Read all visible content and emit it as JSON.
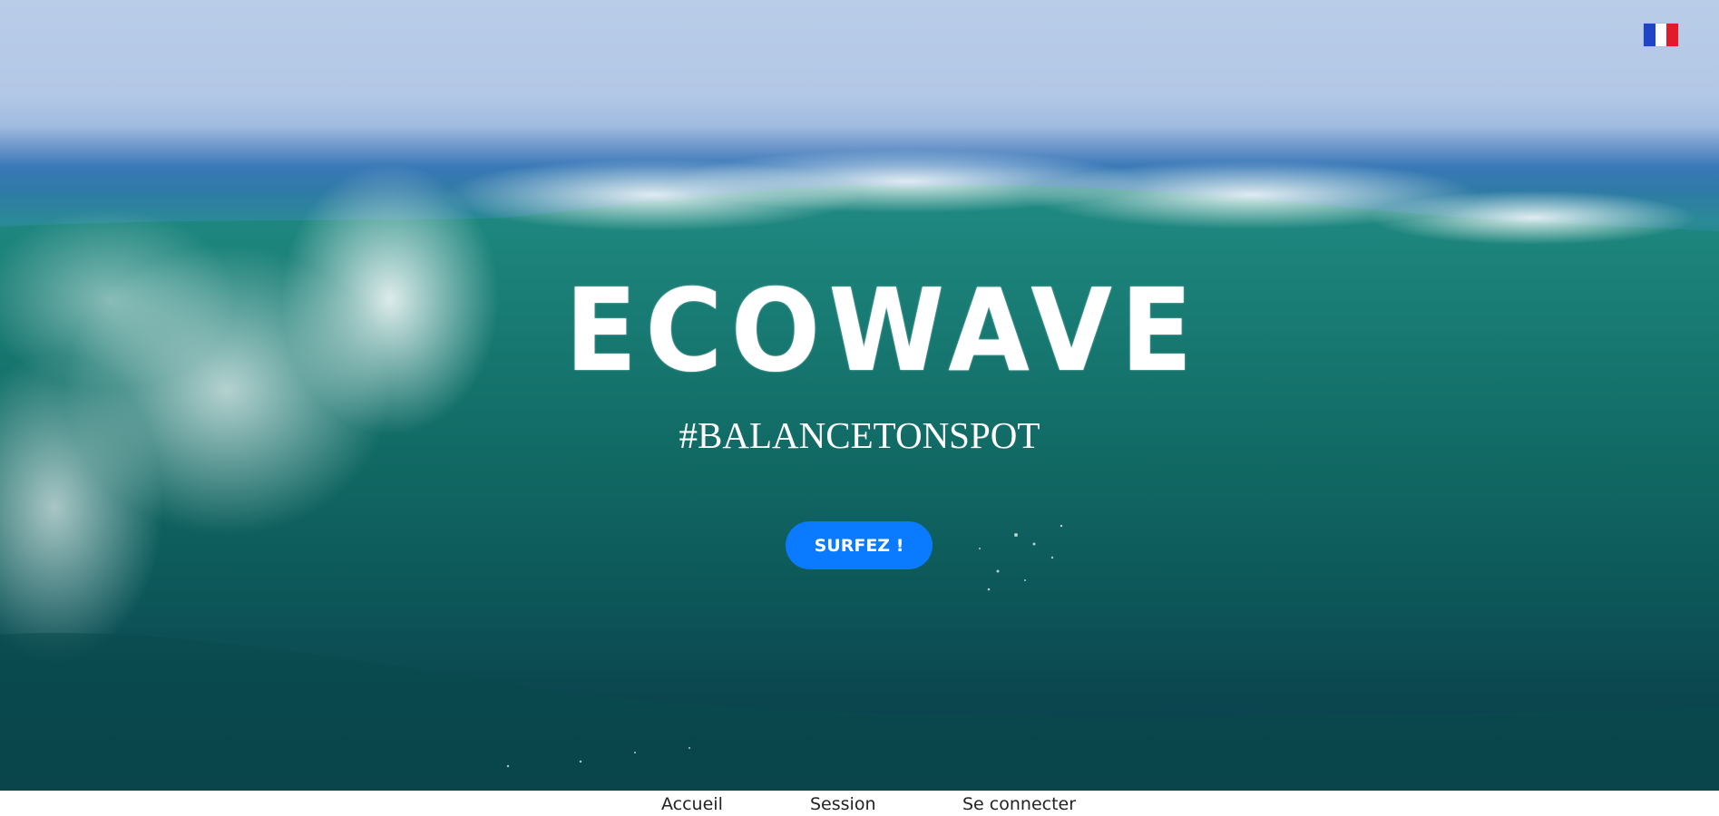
{
  "hero": {
    "background": "ocean-wave-photo",
    "title": "ECOWAVE",
    "tagline": "#BALANCETONSPOT",
    "cta_label": "SURFEZ !"
  },
  "language": {
    "icon": "french-flag-icon",
    "colors": [
      "#1f44c8",
      "#ffffff",
      "#e21b2a"
    ]
  },
  "nav": {
    "items": [
      {
        "label": "Accueil"
      },
      {
        "label": "Session"
      },
      {
        "label": "Se connecter"
      }
    ]
  },
  "colors": {
    "accent": "#0a7aff",
    "sea": "#12706a",
    "sky": "#b9cde9"
  }
}
